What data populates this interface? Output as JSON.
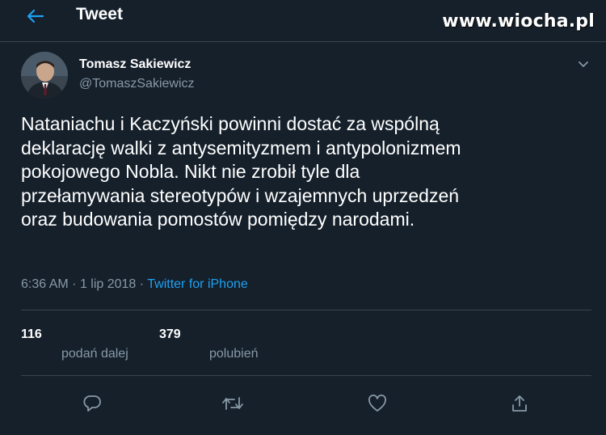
{
  "header": {
    "title": "Tweet",
    "watermark": "www.wiocha.pl"
  },
  "author": {
    "name": "Tomasz Sakiewicz",
    "handle": "@TomaszSakiewicz"
  },
  "tweet": {
    "text_lines": [
      "Nataniachu i Kaczyński powinni dostać za wspólną",
      "deklarację walki z antysemityzmem i antypolonizmem",
      "pokojowego Nobla. Nikt nie zrobił tyle dla",
      "przełamywania stereotypów i wzajemnych uprzedzeń",
      "oraz budowania pomostów pomiędzy narodami."
    ],
    "time": "6:36 AM",
    "date": "1 lip 2018",
    "separator": "·",
    "source": "Twitter for iPhone"
  },
  "stats": {
    "retweets_count": "116",
    "retweets_label": "podań dalej",
    "likes_count": "379",
    "likes_label": "polubień"
  },
  "icons": {
    "back": "arrow-left-icon",
    "caret": "chevron-down-icon",
    "reply": "reply-icon",
    "retweet": "retweet-icon",
    "like": "heart-icon",
    "share": "share-icon"
  },
  "colors": {
    "background": "#15202b",
    "accent": "#1da1f2",
    "secondary_text": "#8899a6",
    "border": "#38444d"
  }
}
